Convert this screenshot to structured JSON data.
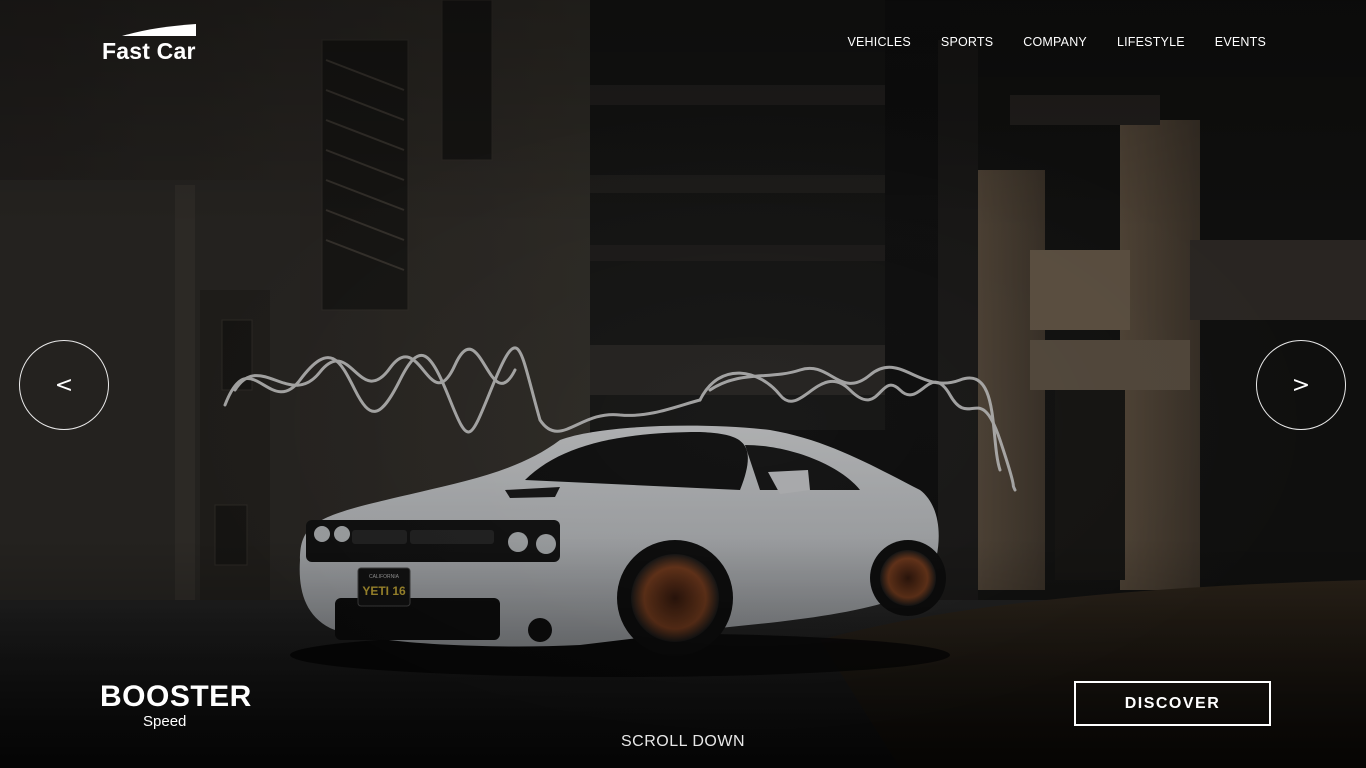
{
  "brand": {
    "name": "Fast Car"
  },
  "nav": {
    "items": [
      {
        "label": "VEHICLES"
      },
      {
        "label": "SPORTS"
      },
      {
        "label": "COMPANY"
      },
      {
        "label": "LIFESTYLE"
      },
      {
        "label": "EVENTS"
      }
    ]
  },
  "slider": {
    "prev_label": "<",
    "next_label": ">",
    "title": "BOOSTER",
    "subtitle": "Speed",
    "plate_text": "YETI 16",
    "plate_state": "CALIFORNIA"
  },
  "cta": {
    "discover_label": "DISCOVER"
  },
  "scroll": {
    "label": "SCROLL DOWN"
  },
  "icons": {
    "prev": "chevron-left-icon",
    "next": "chevron-right-icon",
    "logo": "logo-swoosh-icon"
  },
  "colors": {
    "background": "#0b0b0c",
    "text": "#ffffff",
    "car_body": "#d9dce0",
    "wheel": "#7a3a1a",
    "light_trail": "#f2f2f2"
  }
}
